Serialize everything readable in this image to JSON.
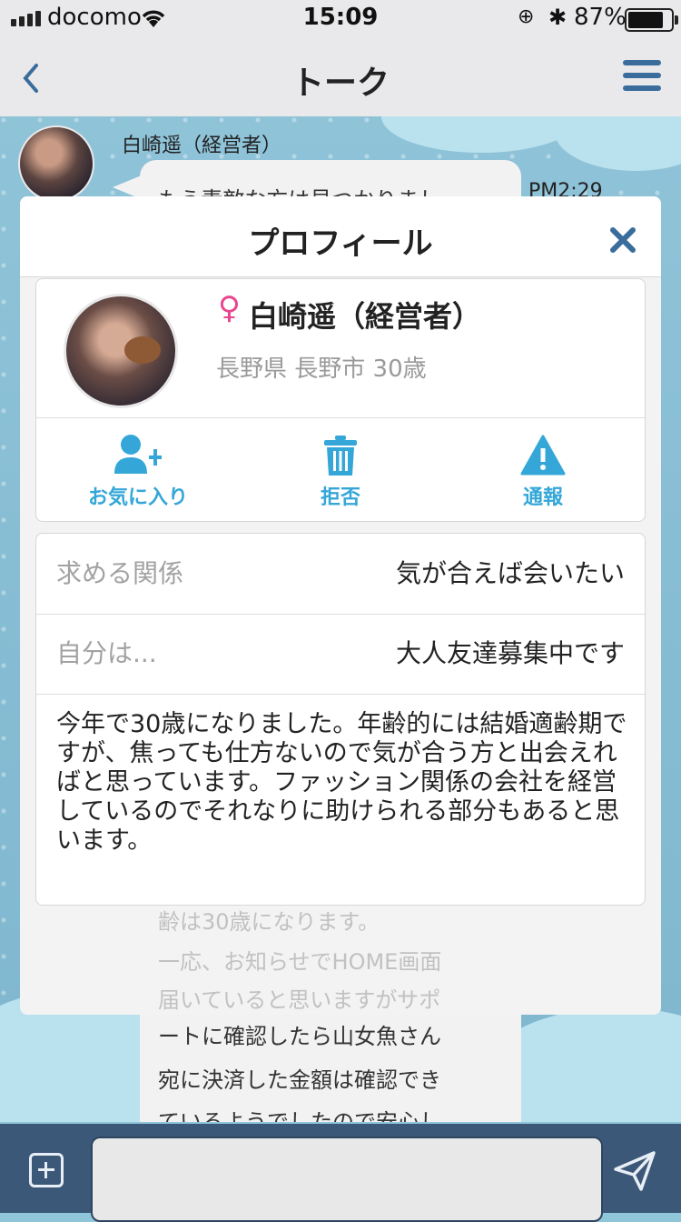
{
  "status_bar": {
    "carrier": "docomo",
    "time": "15:09",
    "battery": "87%"
  },
  "nav": {
    "title": "トーク"
  },
  "chat_background": {
    "sender_name": "白崎遥（経営者）",
    "message_time": "PM2:29",
    "visible_lines": [
      "もう素敵な方は見つかりまし",
      "齢は30歳になります。",
      "一応、お知らせでHOME画面",
      "届いていると思いますがサポ",
      "ートに確認したら山女魚さん",
      "宛に決済した金額は確認でき",
      "ているようでしたので安心し"
    ]
  },
  "modal": {
    "title": "プロフィール",
    "profile": {
      "gender_symbol": "♀",
      "name": "白崎遥（経営者）",
      "location": "長野県 長野市 30歳"
    },
    "actions": [
      {
        "label": "お気に入り",
        "icon": "add-user-icon"
      },
      {
        "label": "拒否",
        "icon": "trash-icon"
      },
      {
        "label": "通報",
        "icon": "warning-icon"
      }
    ],
    "info": {
      "relation_label": "求める関係",
      "relation_value": "気が合えば会いたい",
      "self_label": "自分は...",
      "self_value": "大人友達募集中です",
      "introduction": "今年で30歳になりました。年齢的には結婚適齢期ですが、焦っても仕方ないので気が合う方と出会えればと思っています。ファッション関係の会社を経営しているのでそれなりに助けられる部分もあると思います。"
    },
    "accent_color": "#34a7d8",
    "gender_color": "#e8468e"
  }
}
